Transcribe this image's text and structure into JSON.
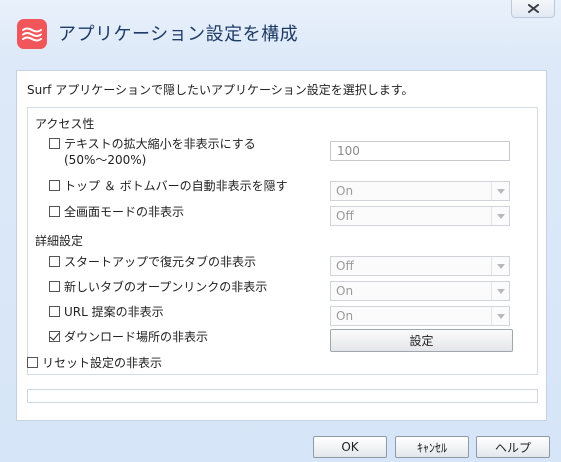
{
  "window": {
    "title": "アプリケーション設定を構成",
    "close_icon": "close-icon",
    "app_icon": "surf-waves-icon",
    "accent_color": "#f0565a"
  },
  "description": "Surf アプリケーションで隠したいアプリケーション設定を選択します。",
  "accessibility": {
    "section_label": "アクセス性",
    "items": [
      {
        "label_line1": "テキストの拡大縮小を非表示にする",
        "label_line2": "(50%～200%)",
        "checked": false,
        "control": "textfield",
        "value": "100"
      },
      {
        "label": "トップ ＆ ボトムバーの自動非表示を隠す",
        "checked": false,
        "control": "select",
        "value": "On"
      },
      {
        "label": "全画面モードの非表示",
        "checked": false,
        "control": "select",
        "value": "Off"
      }
    ]
  },
  "advanced": {
    "section_label": "詳細設定",
    "items": [
      {
        "label": "スタートアップで復元タブの非表示",
        "checked": false,
        "control": "select",
        "value": "Off"
      },
      {
        "label": "新しいタブのオープンリンクの非表示",
        "checked": false,
        "control": "select",
        "value": "On"
      },
      {
        "label": "URL 提案の非表示",
        "checked": false,
        "control": "select",
        "value": "On"
      },
      {
        "label": "ダウンロード場所の非表示",
        "checked": true,
        "control": "button",
        "value": "設定"
      }
    ]
  },
  "reset": {
    "label": "リセット設定の非表示",
    "checked": false
  },
  "footer": {
    "ok_label": "OK",
    "cancel_label": "ｷｬﾝｾﾙ",
    "help_label": "ヘルプ"
  }
}
